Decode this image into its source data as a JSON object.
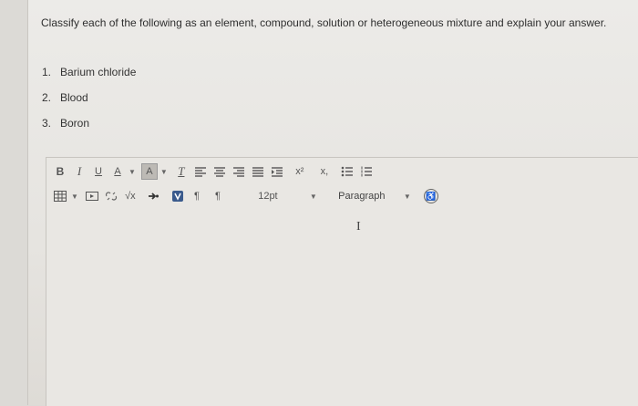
{
  "question": "Classify each of the following as an element, compound, solution or heterogeneous mixture and explain your answer.",
  "items": [
    {
      "num": "1.",
      "label": "Barium chloride"
    },
    {
      "num": "2.",
      "label": "Blood"
    },
    {
      "num": "3.",
      "label": "Boron"
    }
  ],
  "toolbar": {
    "bold": "B",
    "italic": "I",
    "underline": "U",
    "font_color": "A",
    "highlight": "A",
    "clear_format": "T",
    "superscript": "x²",
    "subscript": "x,",
    "font_size": "12pt",
    "paragraph": "Paragraph",
    "sqrt": "√x",
    "ltr": "¶",
    "rtl": "¶",
    "dropdown_caret": "▼"
  },
  "colors": {
    "accent": "#3a5a8c"
  },
  "icons": [
    "table-icon",
    "media-icon",
    "unlink-icon",
    "math-icon",
    "link-icon",
    "video-icon",
    "accessibility-icon",
    "align-left-icon",
    "align-center-icon",
    "align-right-icon",
    "align-justify-icon",
    "indent-icon",
    "bullet-list-icon",
    "numbered-list-icon"
  ]
}
